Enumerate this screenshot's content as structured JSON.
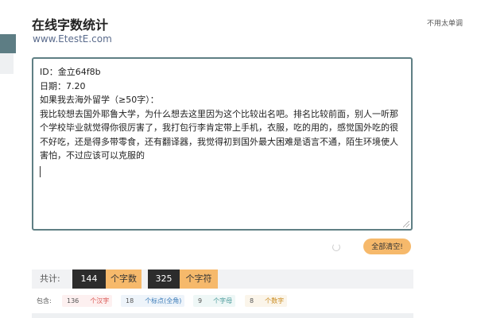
{
  "site": {
    "title": "在线字数统计",
    "url": "www.EtestE.com"
  },
  "corner_link": "不用太单调",
  "editor": {
    "lines": [
      "ID：金立64f8b",
      "日期：7.20",
      "如果我去海外留学（≥50字）：",
      "我比较想去国外耶鲁大学，为什么想去这里因为这个比较出名吧。排名比较前面，别人一听那个学校毕业就觉得你很厉害了，我打包行李肯定带上手机，衣服，吃的用的，感觉国外吃的很不好吃，还是得多带零食，还有翻译器，我觉得初到国外最大困难是语言不通，陌生环境使人害怕，不过应该可以克服的"
    ]
  },
  "clear_button": "全部清空!",
  "stats": {
    "total_label": "共计:",
    "chars_value": "144",
    "chars_unit": "个字数",
    "symbols_value": "325",
    "symbols_unit": "个字符"
  },
  "breakdown": {
    "label": "包含:",
    "items": [
      {
        "value": "136",
        "unit": "个汉字",
        "color": "#d9534f",
        "bg": "#fdf0f0"
      },
      {
        "value": "18",
        "unit": "个标点(全角)",
        "color": "#3b7bb8",
        "bg": "#eef4fa"
      },
      {
        "value": "9",
        "unit": "个字母",
        "color": "#4a9a9a",
        "bg": "#eef7f6"
      },
      {
        "value": "8",
        "unit": "个数字",
        "color": "#c98a1e",
        "bg": "#fbf5ea"
      }
    ]
  }
}
